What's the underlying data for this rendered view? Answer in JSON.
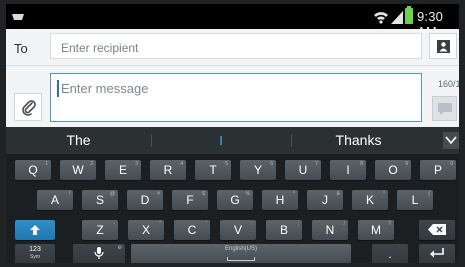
{
  "status_bar": {
    "time": "9:30 AM"
  },
  "compose": {
    "to_label": "To",
    "recipient_placeholder": "Enter recipient",
    "message_placeholder": "Enter message",
    "char_counter": "160/1"
  },
  "suggestions": [
    "The",
    "I",
    "Thanks"
  ],
  "keyboard": {
    "row1": [
      {
        "k": "Q",
        "s": "1"
      },
      {
        "k": "W",
        "s": "2"
      },
      {
        "k": "E",
        "s": "3"
      },
      {
        "k": "R",
        "s": "4"
      },
      {
        "k": "T",
        "s": "5"
      },
      {
        "k": "Y",
        "s": "6"
      },
      {
        "k": "U",
        "s": "7"
      },
      {
        "k": "I",
        "s": "8"
      },
      {
        "k": "O",
        "s": "9"
      },
      {
        "k": "P",
        "s": "0"
      }
    ],
    "row2": [
      {
        "k": "A",
        "s": "!"
      },
      {
        "k": "S",
        "s": "@"
      },
      {
        "k": "D",
        "s": "#"
      },
      {
        "k": "F",
        "s": "$"
      },
      {
        "k": "G",
        "s": "%"
      },
      {
        "k": "H",
        "s": "^"
      },
      {
        "k": "J",
        "s": "&"
      },
      {
        "k": "K",
        "s": "*"
      },
      {
        "k": "L",
        "s": "("
      }
    ],
    "row3": [
      {
        "k": "Z",
        "s": "-"
      },
      {
        "k": "X",
        "s": "\""
      },
      {
        "k": "C",
        "s": "'"
      },
      {
        "k": "V",
        "s": ":"
      },
      {
        "k": "B",
        "s": ";"
      },
      {
        "k": "N",
        "s": "/"
      },
      {
        "k": "M",
        "s": "?"
      }
    ],
    "sym_key_top": "123",
    "sym_key_bottom": "Sym",
    "space_label": "English(US)",
    "period_label": "."
  },
  "colors": {
    "accent": "#41b6f0",
    "battery": "#6ad54b",
    "shift": "#2f8fc9"
  }
}
